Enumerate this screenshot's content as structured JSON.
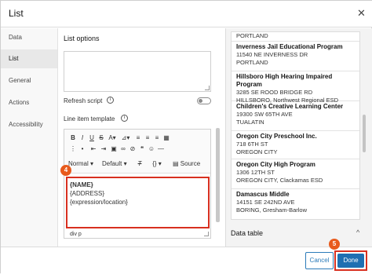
{
  "dialog": {
    "title": "List",
    "close_icon": "close-icon"
  },
  "nav": {
    "items": [
      {
        "label": "Data"
      },
      {
        "label": "List"
      },
      {
        "label": "General"
      },
      {
        "label": "Actions"
      },
      {
        "label": "Accessibility"
      }
    ]
  },
  "settings": {
    "section_title": "List options",
    "refresh_label": "Refresh script",
    "template_label": "Line item template",
    "toolbar": {
      "bold": "B",
      "italic": "I",
      "underline": "U",
      "strike": "S",
      "format_select": "Normal",
      "font_select": "Default",
      "clear_format": "T",
      "braces": "{}",
      "source": "Source"
    },
    "template_lines": [
      "{NAME}",
      "{ADDRESS}",
      "{expression/location}"
    ],
    "path": "div  p"
  },
  "annotations": {
    "badge4": "4",
    "badge5": "5"
  },
  "preview": {
    "items": [
      {
        "name": "",
        "line1": "PORTLAND",
        "line2": ""
      },
      {
        "name": "Inverness Jail Educational Program",
        "line1": "11540 NE INVERNESS DR",
        "line2": "PORTLAND"
      },
      {
        "name": "Hillsboro High Hearing Impaired Program",
        "line1": "3285 SE ROOD BRIDGE RD",
        "line2": "HILLSBORO, Northwest Regional ESD"
      },
      {
        "name": "Children's Creative Learning Center",
        "line1": "19300 SW 65TH AVE",
        "line2": "TUALATIN"
      },
      {
        "name": "Oregon City Preschool Inc.",
        "line1": "718 6TH ST",
        "line2": "OREGON CITY"
      },
      {
        "name": "Oregon City High Program",
        "line1": "1306 12TH ST",
        "line2": "OREGON CITY, Clackamas ESD"
      },
      {
        "name": "Damascus Middle",
        "line1": "14151 SE 242ND AVE",
        "line2": "BORING, Gresham-Barlow"
      }
    ],
    "data_table_label": "Data table"
  },
  "footer": {
    "cancel_label": "Cancel",
    "done_label": "Done"
  },
  "colors": {
    "accent": "#1f6fb2",
    "highlight": "#d83020",
    "badge": "#e85a1c"
  }
}
